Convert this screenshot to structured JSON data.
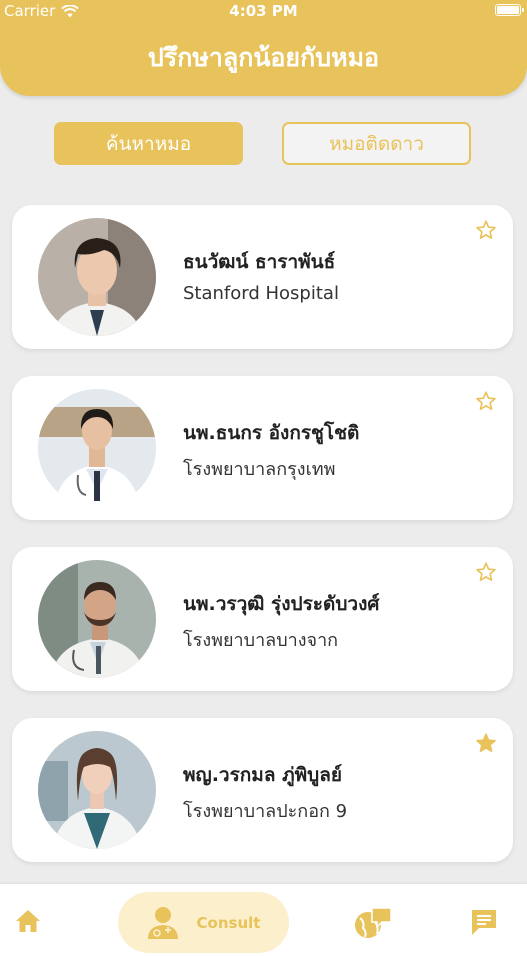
{
  "status_bar": {
    "carrier": "Carrier",
    "time": "4:03 PM"
  },
  "header": {
    "title": "ปรึกษาลูกน้อยกับหมอ"
  },
  "segments": {
    "search": "ค้นหาหมอ",
    "starred": "หมอติดดาว"
  },
  "doctors": [
    {
      "name": "ธนวัฒน์ ธาราพันธ์",
      "hospital": "Stanford Hospital",
      "starred": false
    },
    {
      "name": "นพ.ธนกร  อังกรชูโชติ",
      "hospital": "โรงพยาบาลกรุงเทพ",
      "starred": false
    },
    {
      "name": "นพ.วรวุฒิ รุ่งประดับวงศ์",
      "hospital": "โรงพยาบาลบางจาก",
      "starred": false
    },
    {
      "name": "พญ.วรกมล ภู่พิบูลย์",
      "hospital": "โรงพยาบาลปะกอก 9",
      "starred": true
    }
  ],
  "tabbar": {
    "consult_label": "Consult",
    "active": "consult"
  },
  "colors": {
    "accent": "#e8c25a",
    "accent_light": "#fbefcc",
    "background": "#ececec"
  },
  "icons": [
    "wifi-icon",
    "battery-icon",
    "star-outline-icon",
    "star-filled-icon",
    "home-icon",
    "doctor-icon",
    "globe-chat-icon",
    "chat-icon"
  ]
}
